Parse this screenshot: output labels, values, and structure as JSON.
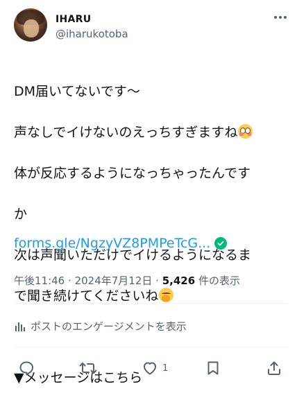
{
  "author": {
    "name": "IHARU",
    "handle": "@iharukotoba"
  },
  "post": {
    "line1": "DM届いてないです～",
    "line2": "声なしでイけないのえっちすぎますね",
    "line3": "体が反応するようになっちゃったんです",
    "line4": "か",
    "line5": "次は声聞いただけでイけるようになるま",
    "line6": "で聞き続けてくださいね",
    "line7": "▼メッセージはこちら",
    "link": "forms.gle/NgzyVZ8PMPeTcG..."
  },
  "meta": {
    "time": "午後11:46",
    "separator": "·",
    "date": "2024年7月12日",
    "views_count": "5,426",
    "views_label": "件の表示"
  },
  "engagement_label": "ポストのエンゲージメントを表示",
  "actions": {
    "like_count": "1"
  },
  "icons": {
    "more": "more-horizontal-icon",
    "reply": "reply-icon",
    "repost": "repost-icon",
    "like": "heart-icon",
    "bookmark": "bookmark-icon",
    "share": "share-icon",
    "analytics": "analytics-bar-icon",
    "verified": "verified-check-icon"
  },
  "colors": {
    "link": "#1d9bf0",
    "secondary_text": "#536471",
    "verified": "#00ba7c"
  }
}
